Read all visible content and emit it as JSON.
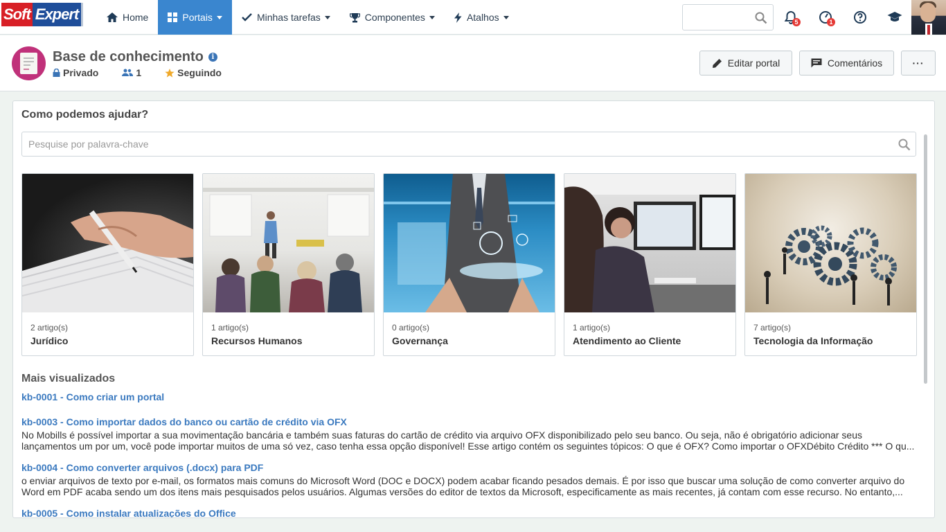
{
  "brand": {
    "soft": "Soft",
    "expert": "Expert"
  },
  "nav": [
    {
      "label": "Home",
      "icon": "home-icon",
      "active": false
    },
    {
      "label": "Portais",
      "icon": "grid-icon",
      "active": true
    },
    {
      "label": "Minhas tarefas",
      "icon": "check-icon",
      "active": false
    },
    {
      "label": "Componentes",
      "icon": "trophy-icon",
      "active": false
    },
    {
      "label": "Atalhos",
      "icon": "bolt-icon",
      "active": false
    }
  ],
  "topbar": {
    "search_placeholder": "",
    "notifications_count": "5",
    "alerts_count": "1",
    "icons": [
      "bell-icon",
      "gauge-icon",
      "help-icon",
      "graduation-cap-icon"
    ]
  },
  "header": {
    "title": "Base de conhecimento",
    "privacy": "Privado",
    "members": "1",
    "follow": "Seguindo",
    "edit_button": "Editar portal",
    "comments_button": "Comentários",
    "more_button": "···"
  },
  "panel": {
    "title": "Como podemos ajudar?",
    "search_placeholder": "Pesquise por palavra-chave"
  },
  "categories": [
    {
      "count": "2 artigo(s)",
      "name": "Jurídico"
    },
    {
      "count": "1 artigo(s)",
      "name": "Recursos Humanos"
    },
    {
      "count": "0 artigo(s)",
      "name": "Governança"
    },
    {
      "count": "1 artigo(s)",
      "name": "Atendimento ao Cliente"
    },
    {
      "count": "7 artigo(s)",
      "name": "Tecnologia da Informação"
    }
  ],
  "most_viewed": {
    "title": "Mais visualizados",
    "articles": [
      {
        "title": "kb-0001 - Como criar um portal",
        "desc": ""
      },
      {
        "title": "kb-0003 - Como importar dados do banco ou cartão de crédito via OFX",
        "desc": "No Mobills é possível importar a sua movimentação bancária e também suas faturas do cartão de crédito via arquivo OFX disponibilizado pelo seu banco. Ou seja, não é obrigatório adicionar seus lançamentos um por um, você pode importar muitos de uma só vez, caso tenha essa opção disponível! Esse artigo contém os seguintes tópicos: O que é OFX? Como importar o OFXDébito Crédito *** O qu..."
      },
      {
        "title": "kb-0004 - Como converter arquivos (.docx) para PDF",
        "desc": "o enviar arquivos de texto por e-mail, os formatos mais comuns do Microsoft Word (DOC e DOCX) podem acabar ficando pesados demais. É por isso que buscar uma solução de como converter arquivo do Word em PDF acaba sendo um dos itens mais pesquisados pelos usuários. Algumas versões do editor de textos da Microsoft, especificamente as mais recentes, já contam com esse recurso. No entanto,..."
      },
      {
        "title": "kb-0005 - Como instalar atualizações do Office",
        "desc": ""
      }
    ]
  },
  "colors": {
    "accent": "#3a86cf",
    "link": "#3a79bf",
    "kb_icon": "#c0317a",
    "badge": "#e53935"
  }
}
